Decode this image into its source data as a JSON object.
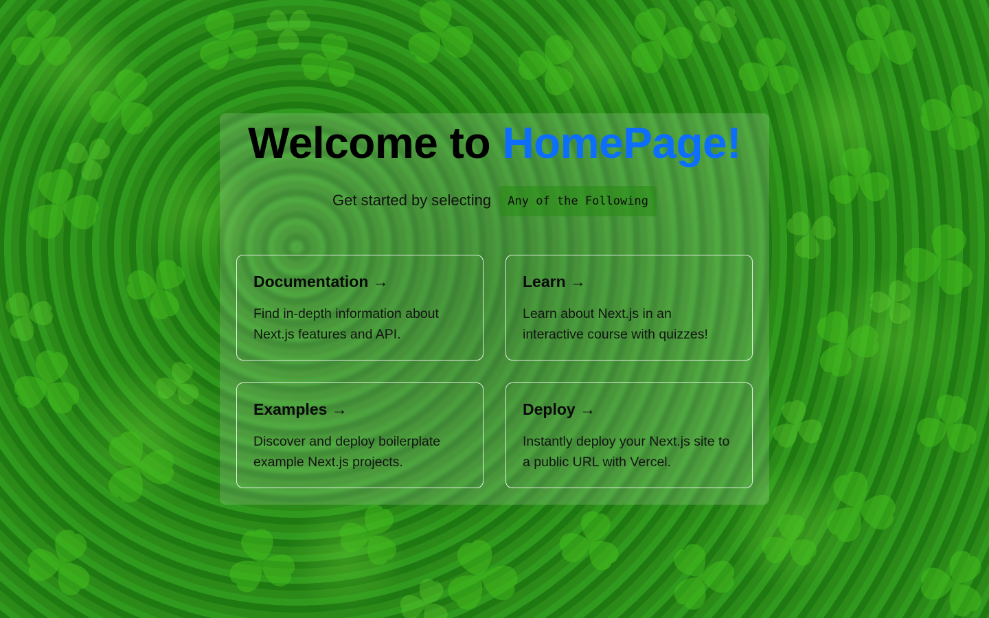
{
  "hero": {
    "title_prefix": "Welcome to ",
    "title_brand": "HomePage!",
    "subtitle": "Get started by selecting",
    "code_label": "Any of the Following"
  },
  "cards": [
    {
      "title": "Documentation",
      "arrow": "→",
      "description": "Find in-depth information about Next.js features and API."
    },
    {
      "title": "Learn",
      "arrow": "→",
      "description": "Learn about Next.js in an interactive course with quizzes!"
    },
    {
      "title": "Examples",
      "arrow": "→",
      "description": "Discover and deploy boilerplate example Next.js projects."
    },
    {
      "title": "Deploy",
      "arrow": "→",
      "description": "Instantly deploy your Next.js site to a public URL with Vercel."
    }
  ],
  "colors": {
    "brand": "#0d6efd",
    "background": "#1f7a14",
    "code_pill": "#2e8c18"
  }
}
